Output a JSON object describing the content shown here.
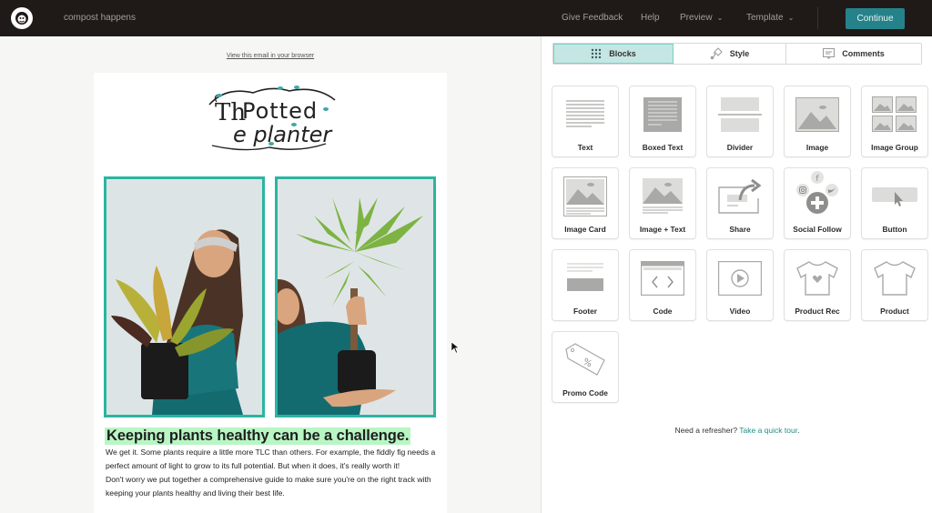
{
  "topbar": {
    "campaign_name": "compost happens",
    "nav": {
      "feedback": "Give Feedback",
      "help": "Help",
      "preview": "Preview",
      "template": "Template"
    },
    "continue_label": "Continue",
    "accent_color": "#26828a"
  },
  "canvas": {
    "view_in_browser": "View this email in your browser",
    "headline": "Keeping plants healthy can be a challenge.",
    "paragraph1": "We get it. Some plants require a little more TLC than others. For example, the fiddly fig needs a perfect amount of light to grow to its full potential. But when it does, it's really worth it!",
    "paragraph2": "Don't worry we put together a comprehensive guide to make sure you're on the right track with keeping your plants healthy and living their best life.",
    "logo_alt": "The Potted Planter",
    "image_border_color": "#2bb5a0",
    "headline_highlight": "#b8f6c4"
  },
  "panel": {
    "tabs": [
      {
        "label": "Blocks",
        "icon": "grid-dots-icon",
        "active": true
      },
      {
        "label": "Style",
        "icon": "paint-brush-icon",
        "active": false
      },
      {
        "label": "Comments",
        "icon": "comment-icon",
        "active": false
      }
    ],
    "blocks": [
      {
        "label": "Text",
        "icon": "text-block-icon"
      },
      {
        "label": "Boxed Text",
        "icon": "boxed-text-icon"
      },
      {
        "label": "Divider",
        "icon": "divider-icon"
      },
      {
        "label": "Image",
        "icon": "image-icon"
      },
      {
        "label": "Image Group",
        "icon": "image-group-icon"
      },
      {
        "label": "Image Card",
        "icon": "image-card-icon"
      },
      {
        "label": "Image + Text",
        "icon": "image-text-icon"
      },
      {
        "label": "Share",
        "icon": "share-icon"
      },
      {
        "label": "Social Follow",
        "icon": "social-follow-icon"
      },
      {
        "label": "Button",
        "icon": "button-block-icon"
      },
      {
        "label": "Footer",
        "icon": "footer-icon"
      },
      {
        "label": "Code",
        "icon": "code-icon"
      },
      {
        "label": "Video",
        "icon": "video-icon"
      },
      {
        "label": "Product Rec",
        "icon": "product-rec-icon"
      },
      {
        "label": "Product",
        "icon": "product-icon"
      },
      {
        "label": "Promo Code",
        "icon": "promo-code-icon"
      }
    ],
    "refresher_text": "Need a refresher?",
    "tour_link": "Take a quick tour",
    "tour_suffix": "."
  }
}
